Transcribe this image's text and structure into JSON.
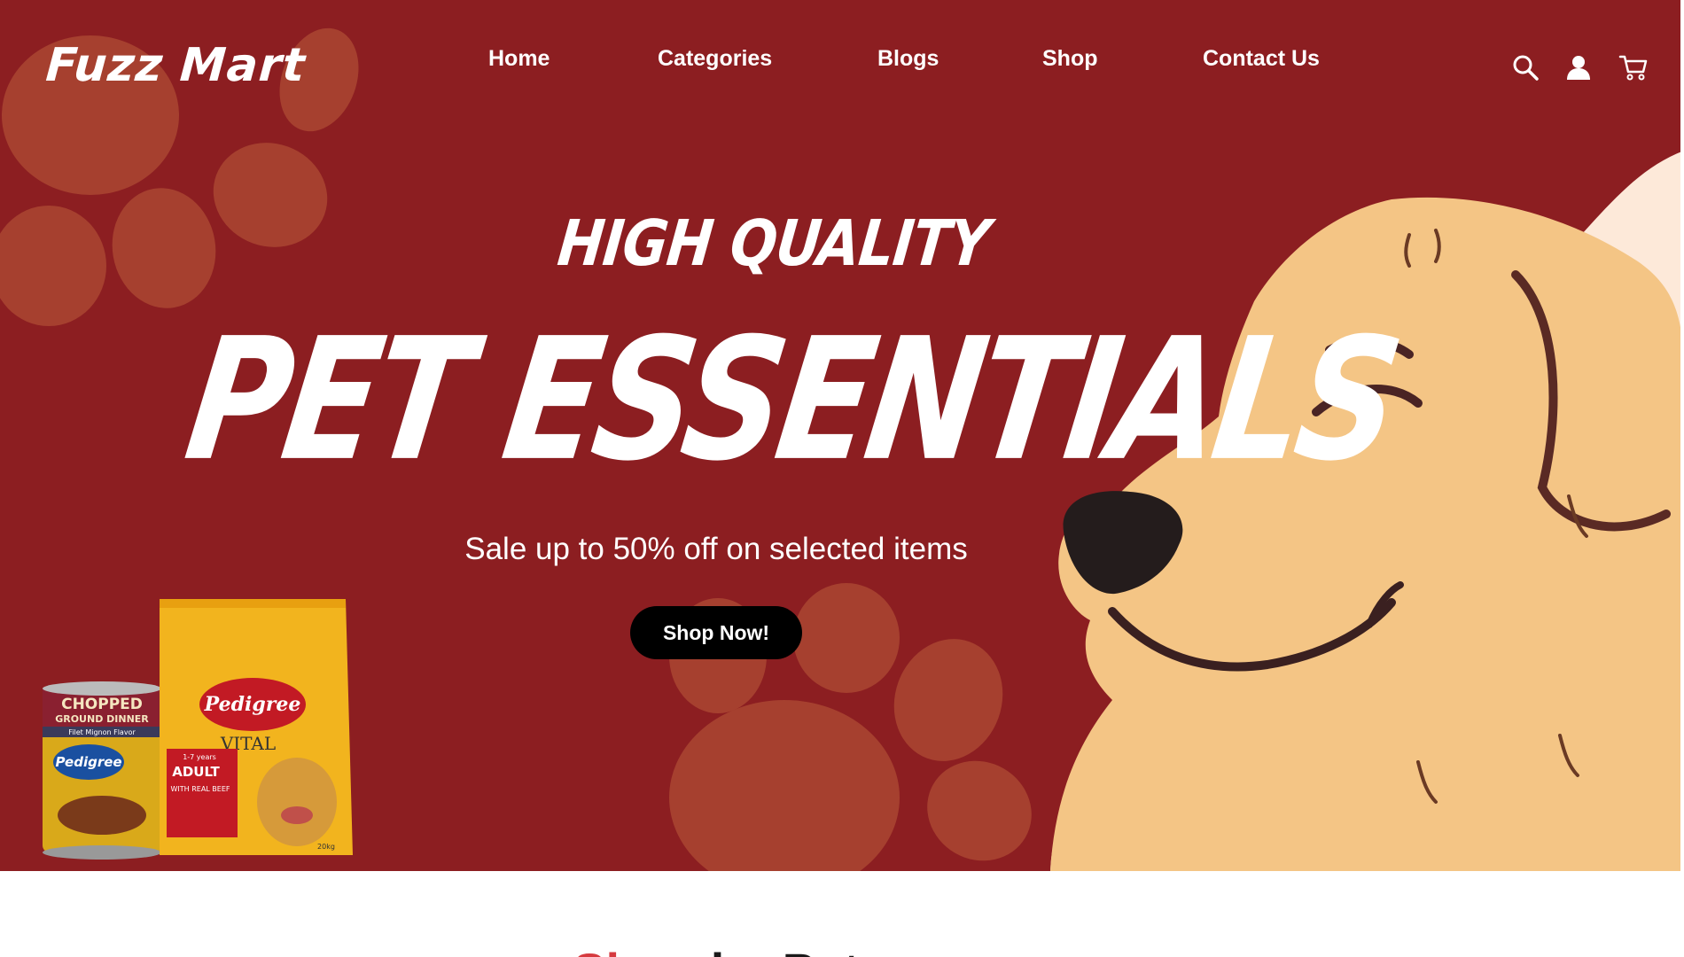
{
  "brand": {
    "name": "Fuzz Mart"
  },
  "nav": {
    "items": [
      {
        "label": "Home"
      },
      {
        "label": "Categories"
      },
      {
        "label": "Blogs"
      },
      {
        "label": "Shop"
      },
      {
        "label": "Contact Us"
      }
    ]
  },
  "header_icons": [
    "search-icon",
    "user-icon",
    "cart-icon"
  ],
  "hero": {
    "kicker": "HIGH QUALITY",
    "headline": "PET ESSENTIALS",
    "subtitle": "Sale up to 50% off on selected items",
    "cta_label": "Shop Now!",
    "products": {
      "can": {
        "line1": "CHOPPED",
        "line2": "GROUND DINNER",
        "flavor": "Filet Mignon Flavor",
        "brand": "Pedigree"
      },
      "bag": {
        "brand": "Pedigree",
        "line": "VITAL",
        "age": "1-7 years",
        "variant": "ADULT",
        "detail": "WITH REAL BEEF",
        "weight": "20kg"
      }
    }
  },
  "section": {
    "title_accent": "Sh",
    "title_rest": "op by Pet"
  },
  "colors": {
    "hero_bg": "#8c1e21",
    "paw": "#a6402f",
    "dog_fur": "#f4c585",
    "cream": "#fde9d9",
    "button": "#000000",
    "accent_red": "#d63a3f"
  }
}
